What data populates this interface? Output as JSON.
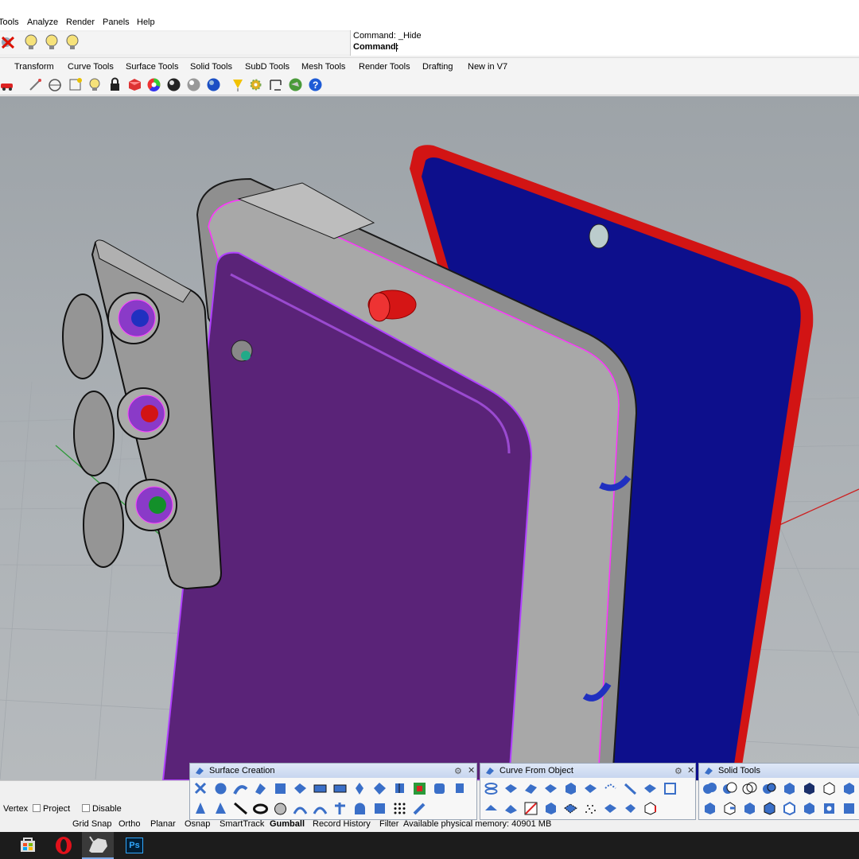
{
  "menu": {
    "items": [
      "Tools",
      "Analyze",
      "Render",
      "Panels",
      "Help"
    ]
  },
  "command": {
    "history": "Command: _Hide",
    "prompt": "Command:",
    "value": ""
  },
  "tabs": [
    "Transform",
    "Curve Tools",
    "Surface Tools",
    "Solid Tools",
    "SubD Tools",
    "Mesh Tools",
    "Render Tools",
    "Drafting",
    "New in V7"
  ],
  "osnap": {
    "vertex": "Vertex",
    "project": "Project",
    "disable": "Disable"
  },
  "status": {
    "grid_snap": "Grid Snap",
    "ortho": "Ortho",
    "planar": "Planar",
    "osnap": "Osnap",
    "smarttrack": "SmartTrack",
    "gumball": "Gumball",
    "record_history": "Record History",
    "filter": "Filter",
    "memory": "Available physical memory: 40901 MB"
  },
  "palettes": {
    "surface_creation": "Surface Creation",
    "curve_from_object": "Curve From Object",
    "solid_tools": "Solid Tools"
  },
  "viewport": {
    "description_colors": {
      "back_panel": "#5a2378",
      "screen": "#0d0f8c",
      "screen_border": "#d21212",
      "frame": "#8e8e8e",
      "camera_module": "#9a9a9a",
      "highlight": "#ff33ff"
    }
  },
  "taskbar": {
    "icons": [
      "store-icon",
      "opera-icon",
      "rhino-icon",
      "photoshop-icon"
    ],
    "photoshop_label": "Ps"
  }
}
